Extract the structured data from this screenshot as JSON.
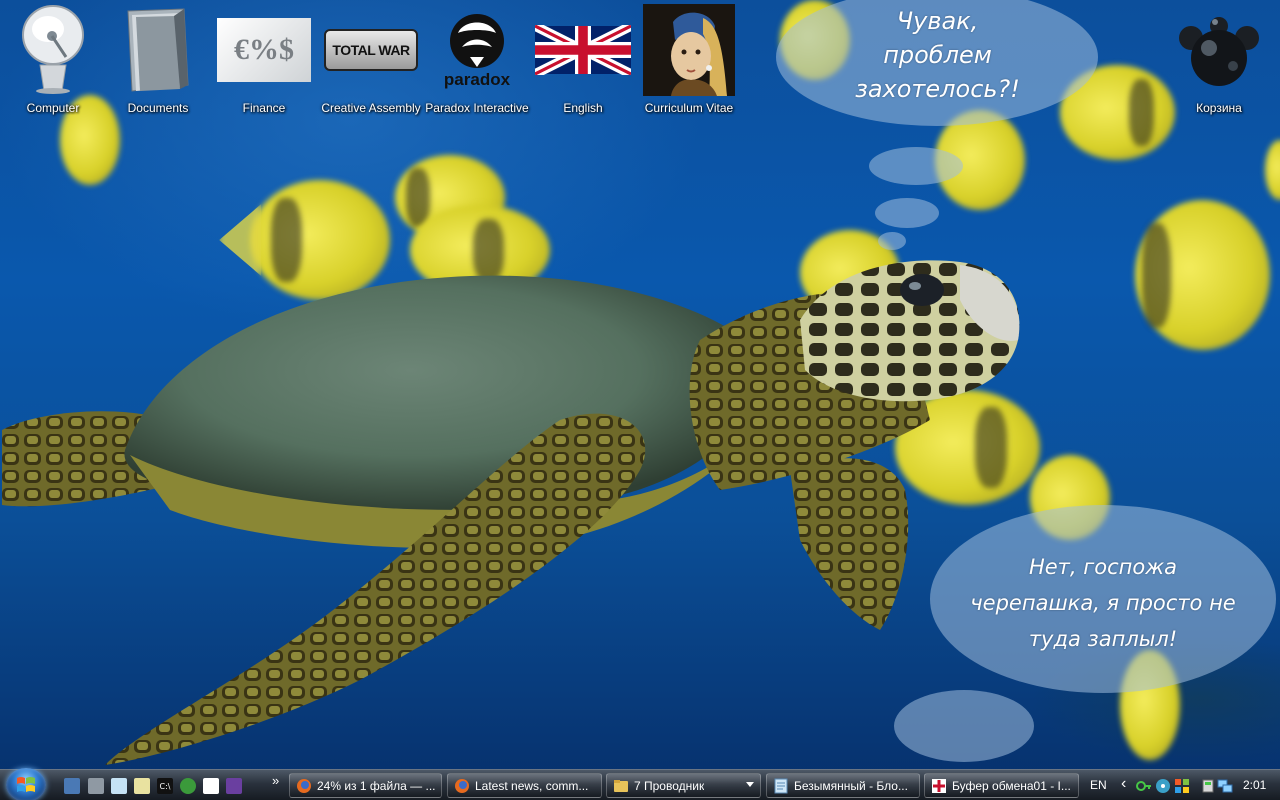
{
  "desktop": {
    "icons": [
      {
        "label": "Computer",
        "icon": "computer-icon"
      },
      {
        "label": "Documents",
        "icon": "documents-folder-icon"
      },
      {
        "label": "Finance",
        "icon": "finance-icon"
      },
      {
        "label": "Creative Assembly",
        "icon": "total-war-logo-icon"
      },
      {
        "label": "Paradox Interactive",
        "icon": "paradox-logo-icon"
      },
      {
        "label": "English",
        "icon": "uk-flag-icon"
      },
      {
        "label": "Curriculum Vitae",
        "icon": "girl-with-pearl-earring-icon"
      },
      {
        "label": "Корзина",
        "icon": "recycle-bin-icon"
      }
    ],
    "icon_art_text": {
      "finance": "€%$",
      "total_war": "TOTAL WAR",
      "paradox": "paradox"
    },
    "bubbles": {
      "top": "Чувак,\nпроблем\nзахотелось?!",
      "bottom": "Нет, госпожа\nчерепашка, я просто не\nтуда заплыл!"
    }
  },
  "taskbar": {
    "start_icon": "windows-start-orb-icon",
    "quick_launch": [
      {
        "icon": "show-desktop-icon"
      },
      {
        "icon": "calculator-icon"
      },
      {
        "icon": "notepad-icon"
      },
      {
        "icon": "notes-icon"
      },
      {
        "icon": "cmd-icon",
        "text": "C:\\"
      },
      {
        "icon": "utorrent-icon"
      },
      {
        "icon": "red-cross-icon"
      },
      {
        "icon": "visual-studio-icon"
      }
    ],
    "overflow_label": "»",
    "tasks": [
      {
        "label": "24% из 1 файла — ...",
        "icon": "firefox-icon"
      },
      {
        "label": "Latest news, comm...",
        "icon": "firefox-icon"
      },
      {
        "label": "7 Проводник",
        "icon": "folder-icon"
      },
      {
        "label": "Безымянный - Бло...",
        "icon": "notepad-icon"
      },
      {
        "label": "Буфер обмена01 - I...",
        "icon": "image-viewer-icon"
      }
    ],
    "language": "EN",
    "tray_arrow": "‹",
    "clock": "2:01"
  },
  "colors": {
    "water": "#0b57a8",
    "bubble": "#a0bedc",
    "taskbar": "#2a323d"
  }
}
